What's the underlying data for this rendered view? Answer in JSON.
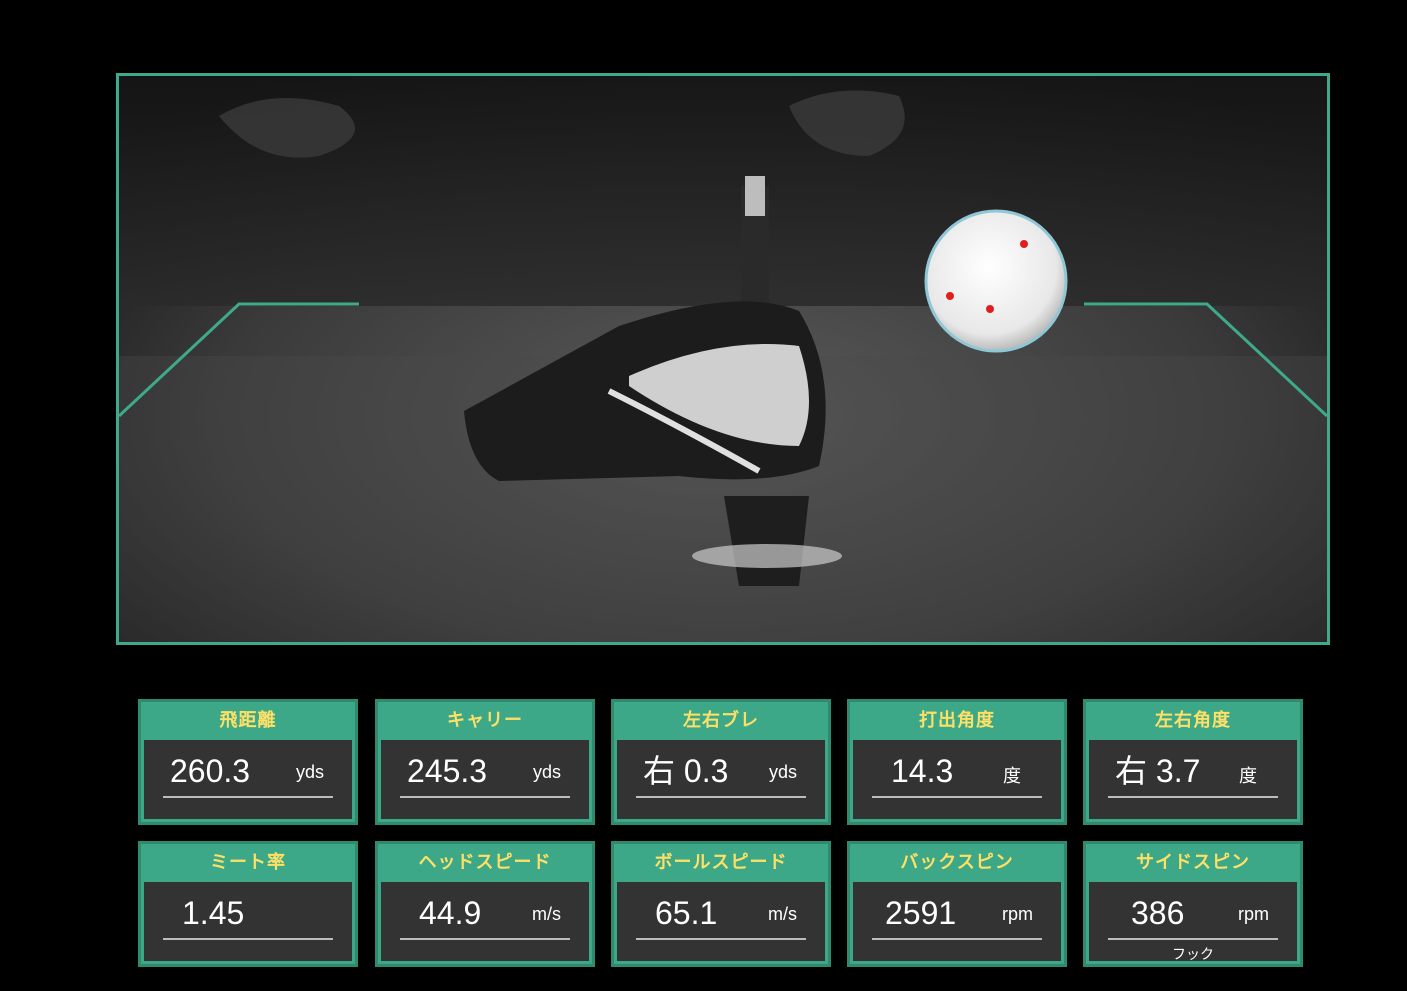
{
  "colors": {
    "frame": "#3fa98b",
    "label_bg": "#3da888",
    "label_text": "#ffe066",
    "value_bg": "#333333",
    "ball_marks": "#e01e1e"
  },
  "viewer": {
    "image_description_icon": "golf-driver-impact-camera-image"
  },
  "stats": {
    "row1": [
      {
        "label": "飛距離",
        "value": "260.3",
        "unit": "yds",
        "note": ""
      },
      {
        "label": "キャリー",
        "value": "245.3",
        "unit": "yds",
        "note": ""
      },
      {
        "label": "左右ブレ",
        "value": "右 0.3",
        "unit": "yds",
        "note": ""
      },
      {
        "label": "打出角度",
        "value": "14.3",
        "unit": "度",
        "note": ""
      },
      {
        "label": "左右角度",
        "value": "右 3.7",
        "unit": "度",
        "note": ""
      }
    ],
    "row2": [
      {
        "label": "ミート率",
        "value": "1.45",
        "unit": "",
        "note": ""
      },
      {
        "label": "ヘッドスピード",
        "value": "44.9",
        "unit": "m/s",
        "note": ""
      },
      {
        "label": "ボールスピード",
        "value": "65.1",
        "unit": "m/s",
        "note": ""
      },
      {
        "label": "バックスピン",
        "value": "2591",
        "unit": "rpm",
        "note": ""
      },
      {
        "label": "サイドスピン",
        "value": "386",
        "unit": "rpm",
        "note": "フック"
      }
    ]
  }
}
